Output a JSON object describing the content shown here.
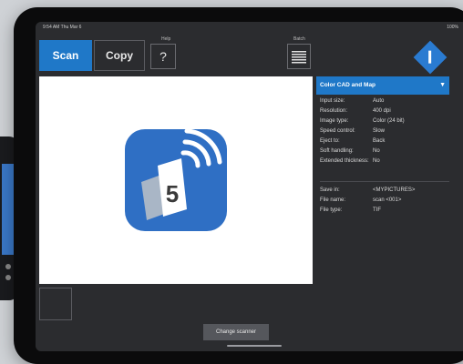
{
  "status": {
    "time": "9:54 AM  Thu Mar 6",
    "battery": "100%"
  },
  "toolbar": {
    "scan_label": "Scan",
    "copy_label": "Copy",
    "help_caption": "Help",
    "help_symbol": "?",
    "batch_caption": "Batch"
  },
  "preview": {
    "app_icon_number": "5"
  },
  "profile": {
    "name": "Color CAD and Map"
  },
  "settings": [
    {
      "label": "Input size:",
      "value": "Auto"
    },
    {
      "label": "Resolution:",
      "value": "400 dpi"
    },
    {
      "label": "Image type:",
      "value": "Color (24 bit)"
    },
    {
      "label": "Speed control:",
      "value": "Slow"
    },
    {
      "label": "Eject to:",
      "value": "Back"
    },
    {
      "label": "Soft handling:",
      "value": "No"
    },
    {
      "label": "Extended thickness:",
      "value": "No"
    }
  ],
  "save": [
    {
      "label": "Save in:",
      "value": "<MYPICTURES>"
    },
    {
      "label": "File name:",
      "value": "scan <001>"
    },
    {
      "label": "File type:",
      "value": "TIF"
    }
  ],
  "footer": {
    "change_scanner_label": "Change scanner"
  },
  "colors": {
    "accent": "#1f78c8",
    "screen_bg": "#2b2c2f",
    "icon_blue": "#2f6fc4"
  }
}
